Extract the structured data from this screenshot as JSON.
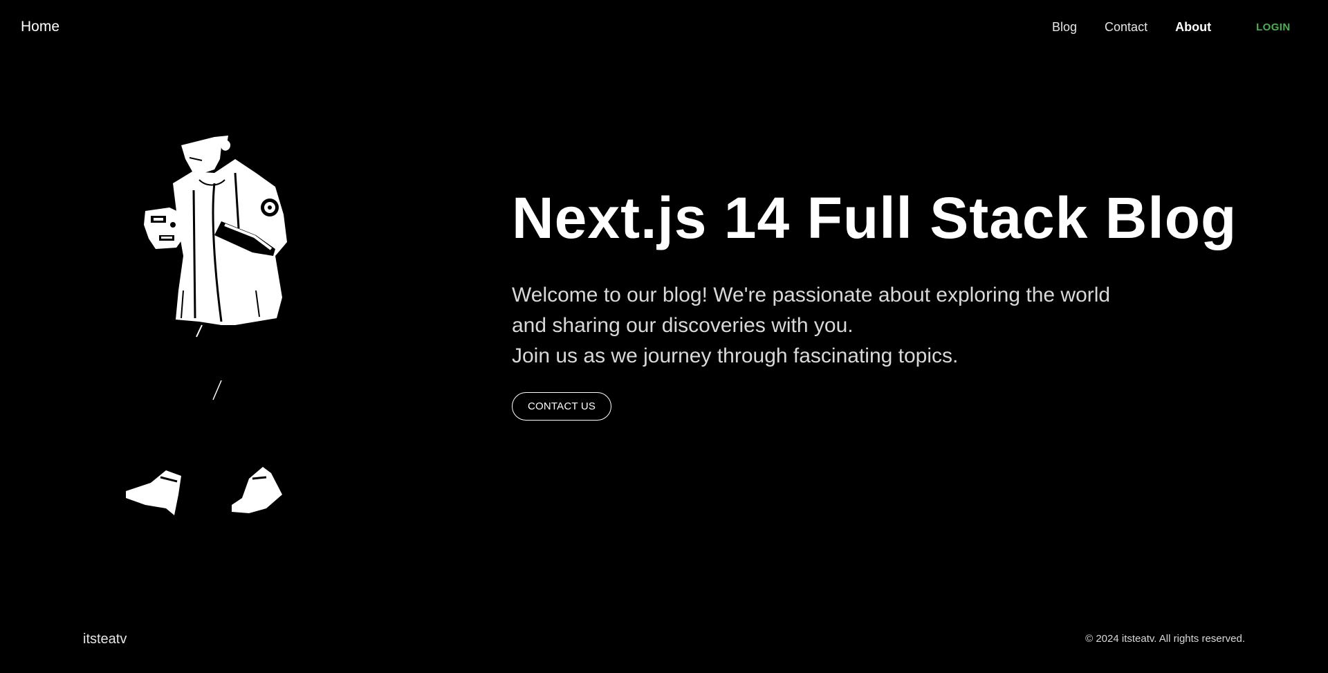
{
  "navbar": {
    "home_label": "Home",
    "links": [
      {
        "label": "Blog"
      },
      {
        "label": "Contact"
      },
      {
        "label": "About"
      }
    ],
    "login_label": "LOGIN",
    "login_color": "#4caf50"
  },
  "hero": {
    "title": "Next.js 14 Full Stack Blog",
    "description_lines": [
      "Welcome to our blog! We're passionate about exploring the world",
      "and sharing our discoveries with you.",
      "Join us as we journey through fascinating topics."
    ],
    "cta_label": "CONTACT US",
    "illustration_icon": "person-holding-phone-illustration"
  },
  "footer": {
    "brand": "itsteatv",
    "copyright": "© 2024 itsteatv. All rights reserved."
  },
  "colors": {
    "background": "#000000",
    "text": "#ffffff",
    "accent": "#4caf50"
  }
}
